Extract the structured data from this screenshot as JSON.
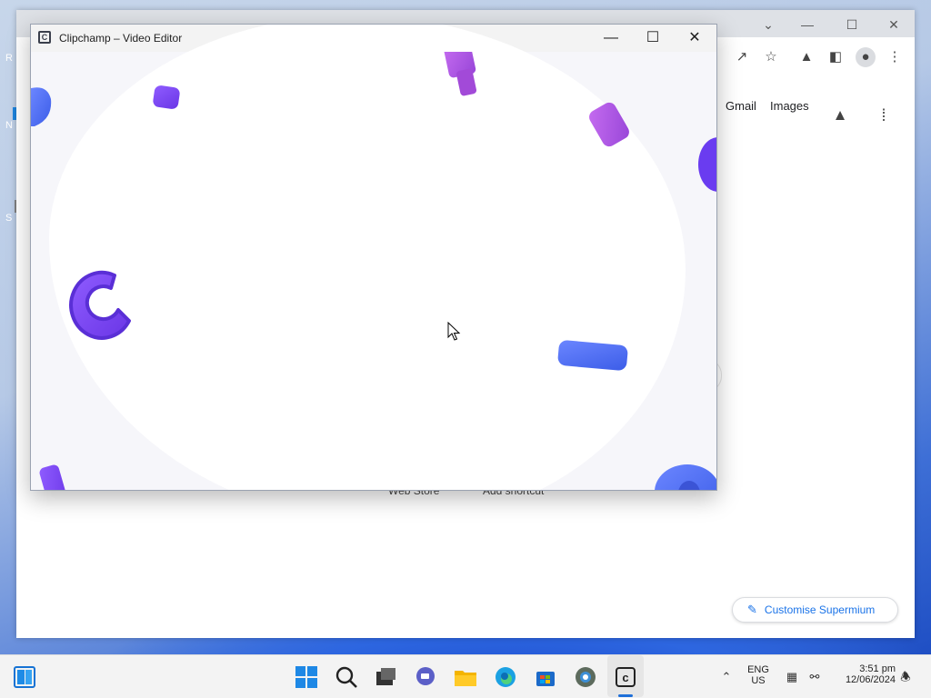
{
  "desktop": {
    "icon_labels": [
      "R",
      "N",
      "S"
    ]
  },
  "browser": {
    "nav_links": {
      "gmail": "Gmail",
      "images": "Images"
    },
    "shortcuts": {
      "web_store": "Web Store",
      "add_shortcut": "Add shortcut"
    },
    "customise_label": "Customise Supermium",
    "accent_color": "#1a73e8"
  },
  "clipchamp": {
    "window_title": "Clipchamp – Video Editor",
    "logo_letter": "C",
    "controls": {
      "minimize": "—",
      "maximize": "☐",
      "close": "✕"
    },
    "shape_colors": [
      "#5b5ff0",
      "#7a3ff2",
      "#b44de0",
      "#4a6ff5",
      "#7b34e6"
    ]
  },
  "taskbar": {
    "language": "ENG",
    "region": "US",
    "time": "3:51 pm",
    "date": "12/06/2024",
    "apps": [
      "widgets-icon",
      "start-icon",
      "search-icon",
      "task-view-icon",
      "teams-chat-icon",
      "file-explorer-icon",
      "edge-icon",
      "store-icon",
      "supermium-icon",
      "clipchamp-icon"
    ]
  }
}
